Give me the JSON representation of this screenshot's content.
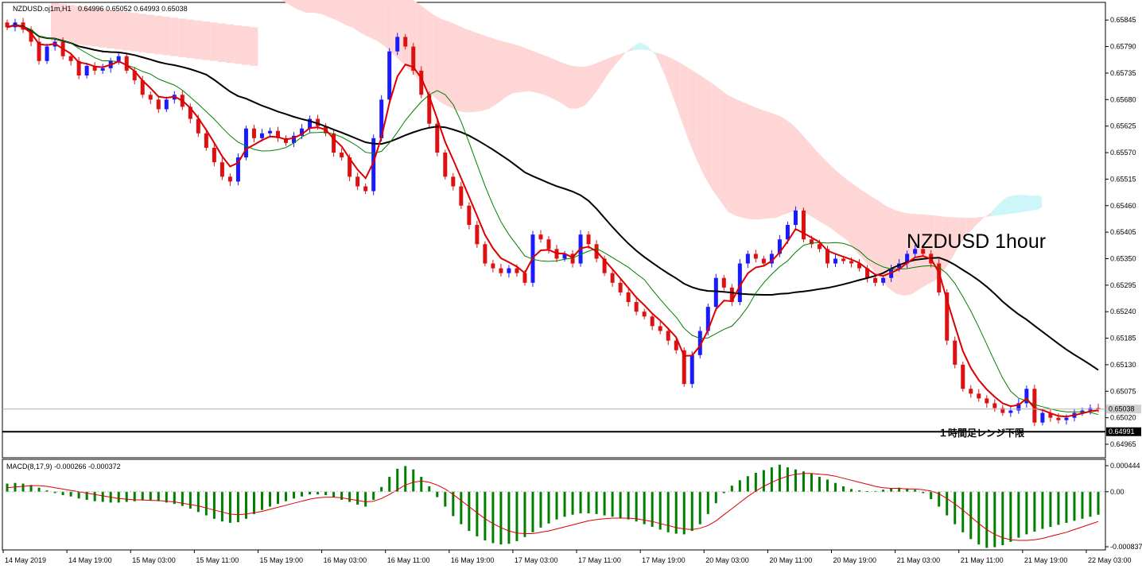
{
  "chart_data": [
    {
      "type": "candlestick",
      "header": {
        "symbol": "NZDUSD.oj1m,H1",
        "ohlc": "0.64996 0.65052 0.64993 0.65038"
      },
      "annotation_title": "NZDUSD 1hour",
      "level_label": "１時間足レンジ下限",
      "current_price_label": "0.65038",
      "level_price_label": "0.64991",
      "current_price": 0.65038,
      "level_price": 0.64991,
      "ylim": [
        0.64937,
        0.6588
      ],
      "y_tick_labels": [
        "0.65845",
        "0.65790",
        "0.65735",
        "0.65680",
        "0.65625",
        "0.65570",
        "0.65515",
        "0.65460",
        "0.65405",
        "0.65350",
        "0.65295",
        "0.65240",
        "0.65185",
        "0.65130",
        "0.65075",
        "0.65020",
        "0.64965"
      ],
      "y_ticks": [
        0.65845,
        0.6579,
        0.65735,
        0.6568,
        0.65625,
        0.6557,
        0.65515,
        0.6546,
        0.65405,
        0.6535,
        0.65295,
        0.6524,
        0.65185,
        0.6513,
        0.65075,
        0.6502,
        0.64965
      ],
      "x_tick_labels": [
        "14 May 2019",
        "14 May 19:00",
        "15 May 03:00",
        "15 May 11:00",
        "15 May 19:00",
        "16 May 03:00",
        "16 May 11:00",
        "16 May 19:00",
        "17 May 03:00",
        "17 May 11:00",
        "17 May 19:00",
        "20 May 03:00",
        "20 May 11:00",
        "20 May 19:00",
        "21 May 03:00",
        "21 May 11:00",
        "21 May 19:00",
        "22 May 03:00"
      ],
      "x_tick_bars": [
        0,
        8,
        16,
        24,
        32,
        40,
        48,
        56,
        64,
        72,
        80,
        88,
        96,
        104,
        112,
        120,
        128,
        136
      ],
      "bar_count": 138,
      "closes": [
        0.6583,
        0.6584,
        0.65825,
        0.658,
        0.6576,
        0.6579,
        0.658,
        0.6577,
        0.6576,
        0.6573,
        0.6575,
        0.6574,
        0.65745,
        0.6576,
        0.6577,
        0.6574,
        0.6572,
        0.6569,
        0.6568,
        0.6566,
        0.6568,
        0.6569,
        0.65665,
        0.6564,
        0.6561,
        0.6558,
        0.6555,
        0.6552,
        0.6551,
        0.6556,
        0.6562,
        0.656,
        0.6561,
        0.65615,
        0.656,
        0.6559,
        0.65605,
        0.6562,
        0.6564,
        0.65625,
        0.6561,
        0.6557,
        0.6556,
        0.6552,
        0.655,
        0.6549,
        0.656,
        0.6568,
        0.6578,
        0.6581,
        0.6579,
        0.6574,
        0.6569,
        0.6563,
        0.6557,
        0.6552,
        0.655,
        0.6546,
        0.6542,
        0.6538,
        0.6534,
        0.6533,
        0.6532,
        0.6533,
        0.6532,
        0.653,
        0.654,
        0.6539,
        0.6537,
        0.6535,
        0.6536,
        0.6534,
        0.654,
        0.6538,
        0.6535,
        0.6532,
        0.653,
        0.6528,
        0.6526,
        0.6524,
        0.6523,
        0.6521,
        0.652,
        0.6518,
        0.6516,
        0.6509,
        0.6515,
        0.652,
        0.6525,
        0.6531,
        0.6529,
        0.6526,
        0.6534,
        0.6536,
        0.6535,
        0.6534,
        0.6536,
        0.6539,
        0.6542,
        0.6545,
        0.6539,
        0.6538,
        0.6537,
        0.6534,
        0.6535,
        0.65345,
        0.6534,
        0.6533,
        0.6531,
        0.653,
        0.6531,
        0.6533,
        0.6534,
        0.6536,
        0.6537,
        0.6536,
        0.6534,
        0.6528,
        0.6518,
        0.6513,
        0.6508,
        0.6507,
        0.6506,
        0.6505,
        0.6504,
        0.6503,
        0.65035,
        0.6505,
        0.6508,
        0.6501,
        0.6503,
        0.6502,
        0.65015,
        0.6502,
        0.6503,
        0.65035,
        0.6504,
        0.65038
      ],
      "series": [
        {
          "name": "",
          "color": "#dd0000",
          "role": "fast-ma"
        },
        {
          "name": "",
          "color": "#008000",
          "role": "slow-line"
        },
        {
          "name": "",
          "color": "#000000",
          "role": "long-ma"
        }
      ],
      "cloud_colors": {
        "bearish": "#ffd6d6",
        "bullish": "#cdf6f8"
      },
      "colors": {
        "bull_candle": "#1a1aff",
        "bear_candle": "#dd1111",
        "grid": "#c8c8c8"
      }
    },
    {
      "type": "bar",
      "header": "MACD(8,17,9) -0.000266 -0.000372",
      "ylim": [
        -0.000837,
        0.000444
      ],
      "y_tick_labels": [
        "0.000444",
        "0.00",
        "-0.000837"
      ],
      "y_ticks": [
        0.000444,
        0.0,
        -0.000837
      ],
      "histogram": [
        0.00012,
        0.00013,
        0.00012,
        0.0001,
        6e-05,
        2e-05,
        -2e-05,
        -5e-05,
        -7e-05,
        -0.0001,
        -0.00012,
        -0.00014,
        -0.00015,
        -0.00016,
        -0.00016,
        -0.00015,
        -0.00014,
        -0.00013,
        -0.00013,
        -0.00014,
        -0.00016,
        -0.00018,
        -0.00021,
        -0.00025,
        -0.0003,
        -0.00035,
        -0.0004,
        -0.00044,
        -0.00046,
        -0.00045,
        -0.0004,
        -0.00033,
        -0.00027,
        -0.00022,
        -0.00018,
        -0.00014,
        -0.0001,
        -7e-05,
        -4e-05,
        -4e-05,
        -5e-05,
        -8e-05,
        -0.00012,
        -0.00015,
        -0.00019,
        -0.00022,
        -0.00012,
        7e-05,
        0.00022,
        0.00034,
        0.00038,
        0.00033,
        0.00022,
        8e-05,
        -8e-05,
        -0.00022,
        -0.00036,
        -0.00048,
        -0.00058,
        -0.00066,
        -0.00072,
        -0.00076,
        -0.00078,
        -0.00077,
        -0.00073,
        -0.00067,
        -0.0006,
        -0.00053,
        -0.00047,
        -0.00041,
        -0.00037,
        -0.00034,
        -0.00032,
        -0.00032,
        -0.00033,
        -0.00035,
        -0.00037,
        -0.00039,
        -0.00041,
        -0.00044,
        -0.00048,
        -0.00052,
        -0.00056,
        -0.0006,
        -0.00062,
        -0.00063,
        -0.00058,
        -0.00048,
        -0.00033,
        -0.00017,
        -2e-05,
        9e-05,
        0.00017,
        0.00023,
        0.00028,
        0.00032,
        0.00036,
        0.0004,
        0.00036,
        0.00033,
        0.0003,
        0.00027,
        0.00022,
        0.00018,
        0.00013,
        8e-05,
        4e-05,
        2e-05,
        1e-05,
        1e-05,
        3e-05,
        5e-05,
        6e-05,
        5e-05,
        3e-05,
        -2e-05,
        -0.00011,
        -0.00022,
        -0.00035,
        -0.00048,
        -0.0006,
        -0.0007,
        -0.00078,
        -0.00083,
        -0.00082,
        -0.00079,
        -0.00074,
        -0.00068,
        -0.00063,
        -0.00059,
        -0.00055,
        -0.00052,
        -0.00049,
        -0.00046,
        -0.00043,
        -0.0004,
        -0.00037,
        -0.00034
      ],
      "signal": [
        6e-05,
        7e-05,
        8e-05,
        9e-05,
        9e-05,
        8e-05,
        6e-05,
        4e-05,
        2e-05,
        0.0,
        -2e-05,
        -4e-05,
        -6e-05,
        -8e-05,
        -0.0001,
        -0.00011,
        -0.00012,
        -0.00012,
        -0.00013,
        -0.00013,
        -0.00014,
        -0.00015,
        -0.00017,
        -0.00019,
        -0.00021,
        -0.00024,
        -0.00027,
        -0.0003,
        -0.00033,
        -0.00034,
        -0.00033,
        -0.00031,
        -0.00029,
        -0.00026,
        -0.00023,
        -0.0002,
        -0.00017,
        -0.00014,
        -0.00011,
        -9e-05,
        -8e-05,
        -8e-05,
        -9e-05,
        -0.00011,
        -0.00013,
        -0.00015,
        -0.00014,
        -0.0001,
        -4e-05,
        3e-05,
        0.0001,
        0.00014,
        0.00016,
        0.00014,
        0.0001,
        4e-05,
        -4e-05,
        -0.00013,
        -0.00022,
        -0.00031,
        -0.0004,
        -0.00047,
        -0.00053,
        -0.00058,
        -0.00061,
        -0.00062,
        -0.00062,
        -0.0006,
        -0.00058,
        -0.00055,
        -0.00052,
        -0.00049,
        -0.00046,
        -0.00043,
        -0.00041,
        -0.0004,
        -0.00039,
        -0.00039,
        -0.00039,
        -0.0004,
        -0.00042,
        -0.00044,
        -0.00047,
        -0.0005,
        -0.00053,
        -0.00055,
        -0.00056,
        -0.00054,
        -0.0005,
        -0.00043,
        -0.00034,
        -0.00025,
        -0.00016,
        -7e-05,
        1e-05,
        8e-05,
        0.00014,
        0.00019,
        0.00023,
        0.00026,
        0.00027,
        0.00027,
        0.00026,
        0.00025,
        0.00023,
        0.0002,
        0.00017,
        0.00014,
        0.00011,
        8e-05,
        6e-05,
        5e-05,
        5e-05,
        4e-05,
        4e-05,
        3e-05,
        1e-05,
        -3e-05,
        -0.0001,
        -0.00018,
        -0.00027,
        -0.00037,
        -0.00047,
        -0.00056,
        -0.00063,
        -0.00068,
        -0.00071,
        -0.00072,
        -0.00072,
        -0.00071,
        -0.00069,
        -0.00066,
        -0.00063,
        -0.0006,
        -0.00056,
        -0.00052,
        -0.00048,
        -0.00044
      ],
      "colors": {
        "histogram": "#008000",
        "signal": "#dd0000"
      }
    }
  ]
}
